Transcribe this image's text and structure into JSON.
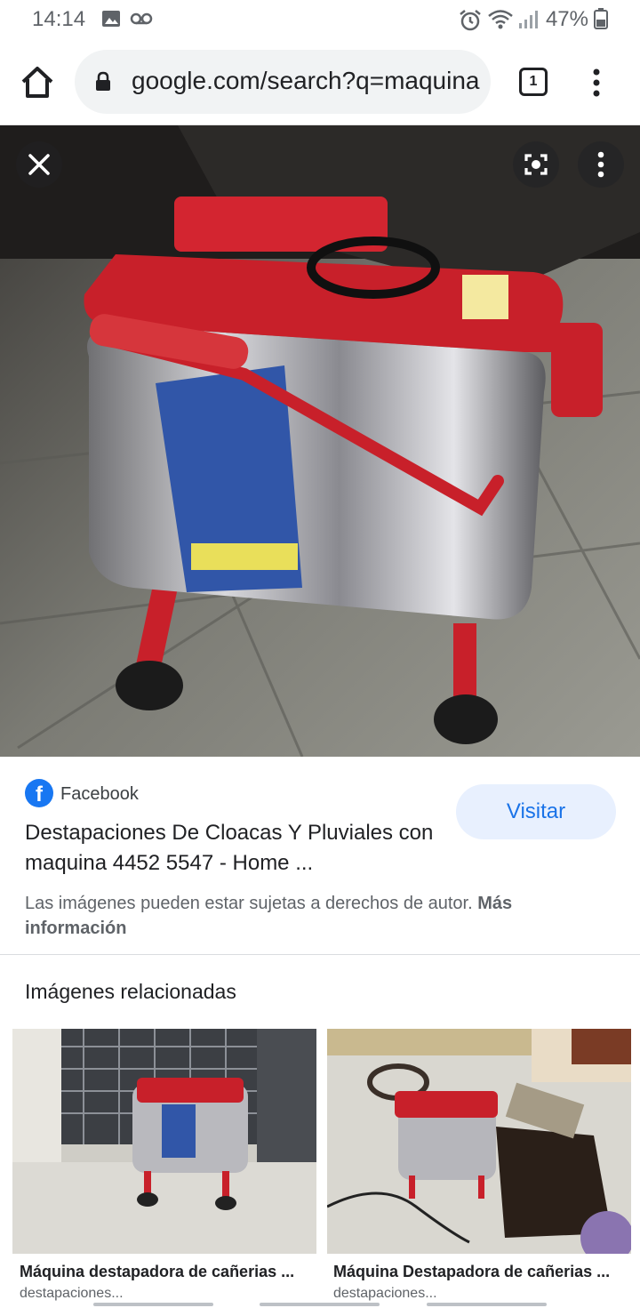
{
  "status_bar": {
    "time": "14:14",
    "battery": "47%"
  },
  "browser": {
    "url": "google.com/search?q=maquina",
    "tab_count": "1"
  },
  "image_viewer": {
    "close_icon": "close-icon",
    "lens_icon": "google-lens-icon",
    "more_icon": "more-vert-icon"
  },
  "result": {
    "source": "Facebook",
    "title": "Destapaciones De Cloacas Y Pluviales con maquina 4452 5547 - Home ...",
    "visit_label": "Visitar",
    "copyright_text": "Las imágenes pueden estar sujetas a derechos de autor.",
    "more_info_label": "Más información"
  },
  "related": {
    "heading": "Imágenes relacionadas",
    "items": [
      {
        "caption": "Máquina destapadora de cañerias ...",
        "sub": "destapaciones..."
      },
      {
        "caption": "Máquina Destapadora de cañerias ...",
        "sub": "destapaciones..."
      }
    ]
  },
  "colors": {
    "accent": "#1a73e8",
    "visit_bg": "#e8f0fe",
    "facebook": "#1877f2",
    "machine_red": "#c8202a"
  }
}
